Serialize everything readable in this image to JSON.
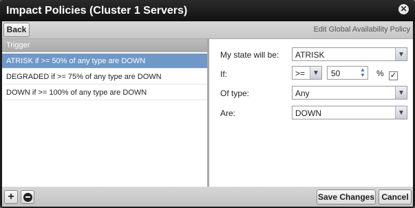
{
  "dialog": {
    "title": "Impact Policies (Cluster 1 Servers)",
    "close_icon": "close-icon"
  },
  "toolbar": {
    "back_label": "Back",
    "edit_link": "Edit Global Availability Policy"
  },
  "list": {
    "header": "Trigger",
    "rows": [
      {
        "label": "ATRISK if >= 50% of any type are DOWN",
        "selected": true
      },
      {
        "label": "DEGRADED if >= 75% of any type are DOWN",
        "selected": false
      },
      {
        "label": "DOWN if >= 100% of any type are DOWN",
        "selected": false
      }
    ]
  },
  "form": {
    "state_label": "My state will be:",
    "state_value": "ATRISK",
    "if_label": "If:",
    "operator_value": ">=",
    "threshold_value": "50",
    "percent_symbol": "%",
    "percent_checked": true,
    "type_label": "Of type:",
    "type_value": "Any",
    "are_label": "Are:",
    "are_value": "DOWN"
  },
  "footer": {
    "add_icon": "plus-icon",
    "remove_icon": "minus-circle-icon",
    "save_label": "Save Changes",
    "cancel_label": "Cancel"
  },
  "colors": {
    "selected_row": "#6f98c8",
    "titlebar": "#1b1b1b"
  }
}
